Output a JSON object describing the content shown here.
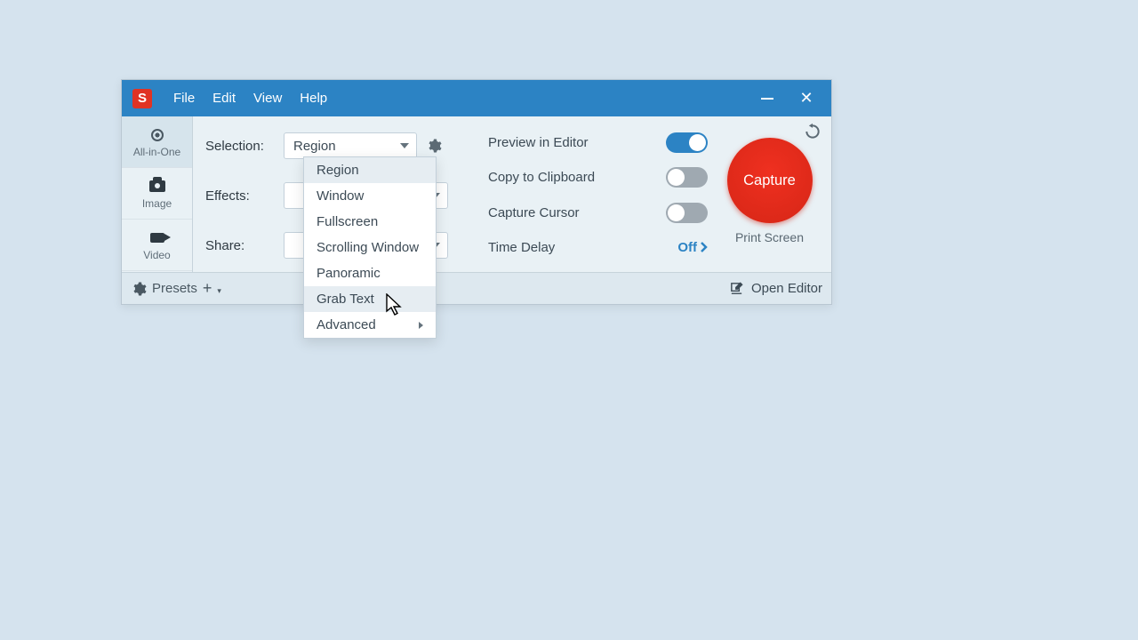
{
  "app_logo_letter": "S",
  "menubar": {
    "file": "File",
    "edit": "Edit",
    "view": "View",
    "help": "Help"
  },
  "tabs": {
    "all_in_one": "All-in-One",
    "image": "Image",
    "video": "Video"
  },
  "labels": {
    "selection": "Selection:",
    "effects": "Effects:",
    "share": "Share:"
  },
  "dropdowns": {
    "selection_value": "Region"
  },
  "options": {
    "preview": "Preview in Editor",
    "clipboard": "Copy to Clipboard",
    "cursor": "Capture Cursor",
    "time_delay": "Time Delay",
    "time_delay_value": "Off",
    "preview_on": true,
    "clipboard_on": false,
    "cursor_on": false
  },
  "capture": {
    "button": "Capture",
    "shortcut": "Print Screen"
  },
  "footer": {
    "presets": "Presets",
    "open_editor": "Open Editor"
  },
  "selection_menu": {
    "items": [
      {
        "label": "Region"
      },
      {
        "label": "Window"
      },
      {
        "label": "Fullscreen"
      },
      {
        "label": "Scrolling Window"
      },
      {
        "label": "Panoramic"
      },
      {
        "label": "Grab Text"
      },
      {
        "label": "Advanced",
        "has_submenu": true
      }
    ],
    "selected_index": 0,
    "hover_index": 5
  }
}
